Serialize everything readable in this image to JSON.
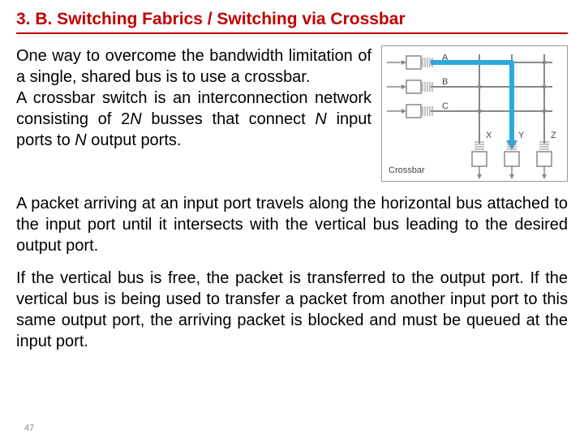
{
  "title": "3. B. Switching Fabrics / Switching via Crossbar",
  "para1a": "One way to overcome the bandwidth limitation of a single, shared bus is to use a crossbar.",
  "para1b_pre": "A crossbar switch is an interconnection network consisting of 2",
  "var_N1": "N",
  "para1b_mid": " busses that connect ",
  "var_N2": "N",
  "para1b_mid2": " input ports to ",
  "var_N3": "N",
  "para1b_end": " output ports.",
  "para2": "A packet arriving at an input port travels along the horizontal bus attached to the input port until it intersects with the vertical bus leading to the desired output port.",
  "para3": "If the vertical bus is free, the packet is transferred to the output port. If the vertical bus is being used to transfer a packet from another input port to this same output port, the arriving packet is blocked and must be queued at the input port.",
  "pagenum": "47",
  "diagram": {
    "in_labels": [
      "A",
      "B",
      "C"
    ],
    "out_labels": [
      "X",
      "Y",
      "Z"
    ],
    "caption": "Crossbar"
  }
}
